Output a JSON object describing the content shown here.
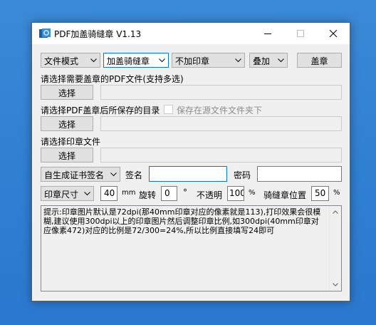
{
  "window": {
    "title": "PDF加盖骑缝章 V1.13"
  },
  "toolbar": {
    "file_mode": "文件模式",
    "seal_mode": "加盖骑缝章",
    "stamp_option": "不加印章",
    "overlay": "叠加",
    "stamp_button": "盖章"
  },
  "section1": {
    "label": "请选择需要盖章的PDF文件(支持多选)",
    "button": "选择",
    "path": ""
  },
  "section2": {
    "label": "请选择PDF盖章后所保存的目录",
    "checkbox_label": "保存在源文件文件夹下",
    "button": "选择",
    "path": ""
  },
  "section3": {
    "label": "请选择印章文件",
    "button": "选择",
    "path": ""
  },
  "cert": {
    "select": "自生成证书签名",
    "sign_label": "签名",
    "sign_value": "",
    "password_label": "密码",
    "password_value": ""
  },
  "params": {
    "size_select": "印章尺寸",
    "size_value": "40",
    "size_unit": "mm",
    "rotate_label": "旋转",
    "rotate_value": "0",
    "rotate_unit": "°",
    "opacity_label": "不透明",
    "opacity_value": "100",
    "opacity_unit": "%",
    "position_label": "骑缝章位置",
    "position_value": "50",
    "position_unit": "%"
  },
  "memo": {
    "text": "提示:印章图片默认是72dpi(那40mm印章对应的像素就是113),打印效果会很模糊,建议使用300dpi以上的印章图片然后调整印章比例,如300dpi(40mm印章对应像素472)对应的比例是72/300=24%,所以比例直接填写24即可"
  },
  "colors": {
    "accent": "#0078d7",
    "desktop": "#2f7fd2"
  }
}
